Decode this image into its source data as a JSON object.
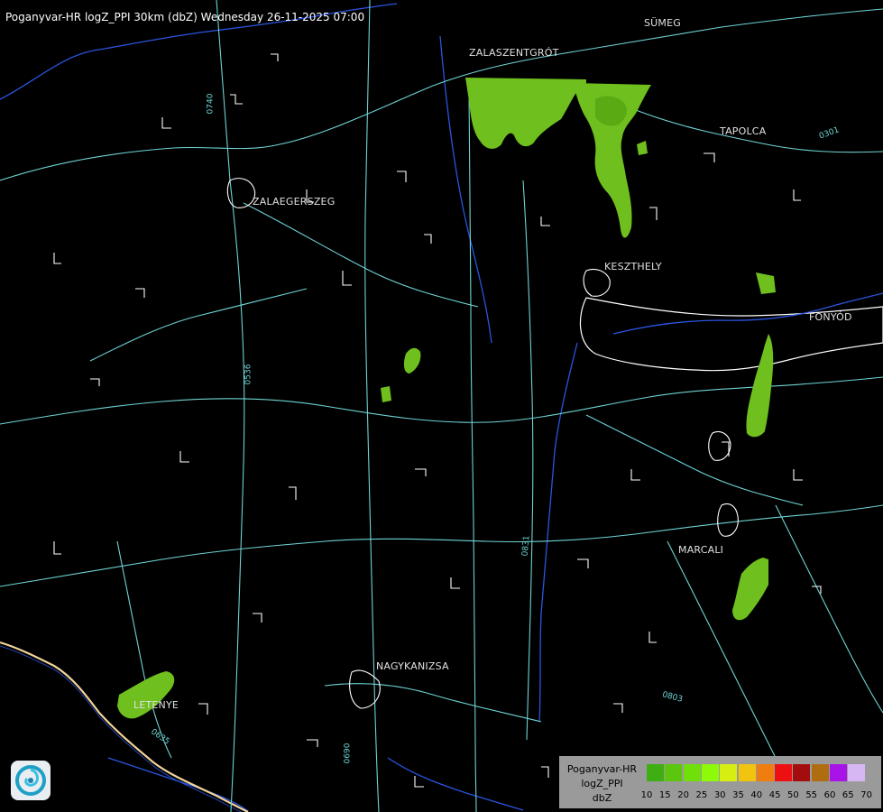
{
  "title": "Poganyvar-HR logZ_PPI 30km (dbZ) Wednesday 26-11-2025 07:00",
  "cities": {
    "sumeg": "SÜMEG",
    "zalaszentgrot": "ZALASZENTGRÓT",
    "tapolca": "TAPOLCA",
    "zalaegerszeg": "ZALAEGERSZEG",
    "keszthely": "KESZTHELY",
    "fonyod": "FONYÓD",
    "marcali": "MARCALI",
    "nagykanizsa": "NAGYKANIZSA",
    "letenye": "LETENYE"
  },
  "roads": {
    "r0740": "0740",
    "r0536": "0536",
    "r0831": "0831",
    "r0803": "0803",
    "r0301": "0301",
    "r0635": "0635",
    "r0690": "0690"
  },
  "legend": {
    "line1": "Poganyvar-HR",
    "line2": "logZ_PPI",
    "line3": "dbZ",
    "ticks": [
      "10",
      "15",
      "20",
      "25",
      "30",
      "35",
      "40",
      "45",
      "50",
      "55",
      "60",
      "65",
      "70"
    ],
    "colors": [
      "#3fae12",
      "#5cc50e",
      "#6fe00a",
      "#8dfa0a",
      "#d7ee12",
      "#f1c40f",
      "#f07d10",
      "#ee1010",
      "#a30d0d",
      "#b06d0f",
      "#a814e8",
      "#d7b7f3"
    ]
  },
  "colors": {
    "echo_light": "#6fbf1f",
    "echo_mid": "#5aaa14",
    "roads": "#6fd3d3",
    "water": "#2a55e0",
    "borders": "#ffffff"
  }
}
